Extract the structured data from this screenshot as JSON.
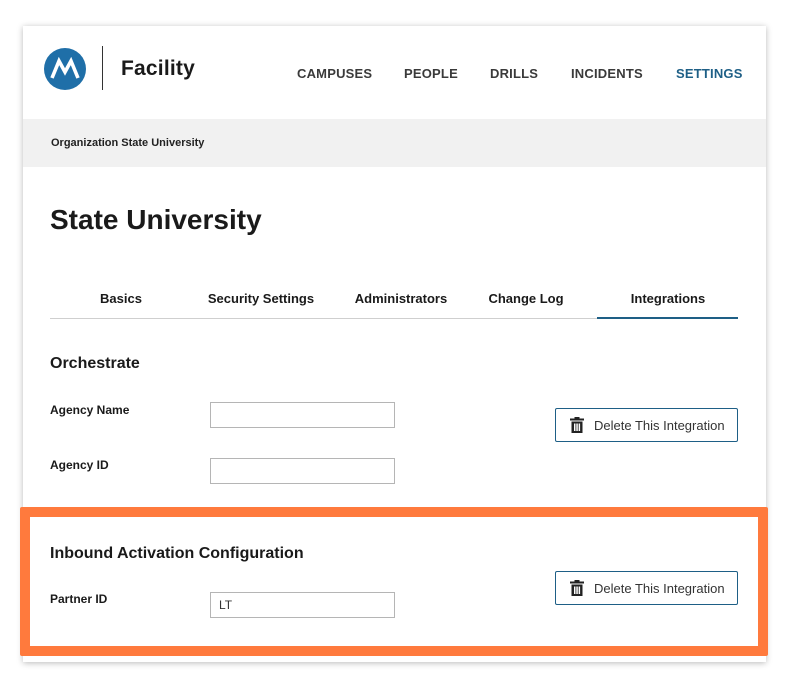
{
  "header": {
    "brand": "Facility",
    "nav": [
      {
        "label": "CAMPUSES",
        "active": false
      },
      {
        "label": "PEOPLE",
        "active": false
      },
      {
        "label": "DRILLS",
        "active": false
      },
      {
        "label": "INCIDENTS",
        "active": false
      },
      {
        "label": "SETTINGS",
        "active": true
      }
    ]
  },
  "breadcrumb": "Organization State University",
  "page_title": "State University",
  "tabs": [
    {
      "label": "Basics",
      "active": false
    },
    {
      "label": "Security Settings",
      "active": false
    },
    {
      "label": "Administrators",
      "active": false
    },
    {
      "label": "Change Log",
      "active": false
    },
    {
      "label": "Integrations",
      "active": true
    }
  ],
  "orchestrate": {
    "title": "Orchestrate",
    "agency_name_label": "Agency Name",
    "agency_name_value": "",
    "agency_id_label": "Agency ID",
    "agency_id_value": "",
    "delete_label": "Delete This Integration"
  },
  "inbound": {
    "title": "Inbound Activation Configuration",
    "partner_id_label": "Partner ID",
    "partner_id_value": "LT",
    "delete_label": "Delete This Integration"
  },
  "colors": {
    "accent": "#1e5f86",
    "logo": "#1f6fa8",
    "highlight": "#ff7a3d"
  }
}
